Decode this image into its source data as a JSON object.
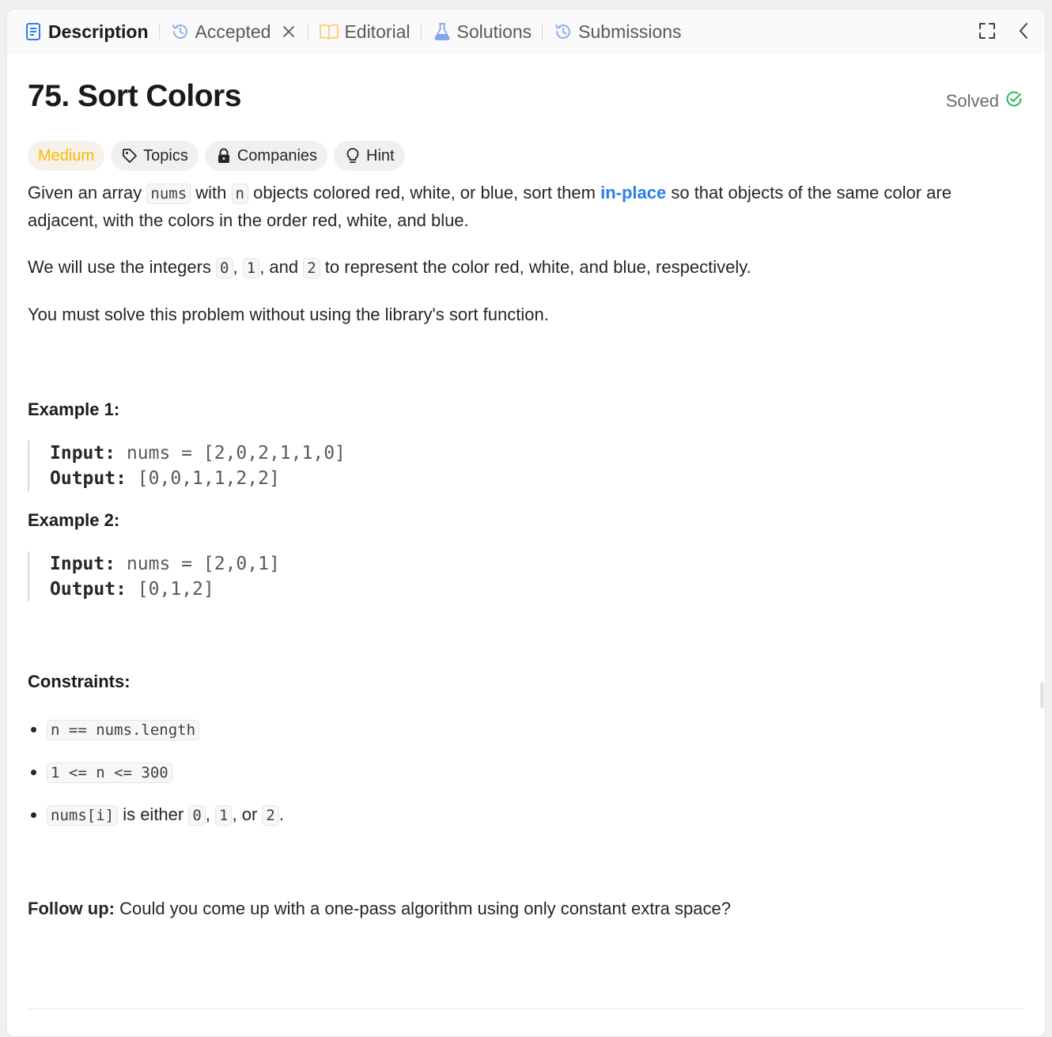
{
  "tabs": {
    "description": "Description",
    "accepted": "Accepted",
    "editorial": "Editorial",
    "solutions": "Solutions",
    "submissions": "Submissions"
  },
  "problem": {
    "title": "75. Sort Colors",
    "status": "Solved",
    "difficulty": "Medium",
    "chips": {
      "topics": "Topics",
      "companies": "Companies",
      "hint": "Hint"
    }
  },
  "description": {
    "p1": {
      "t1": "Given an array ",
      "c1": "nums",
      "t2": " with ",
      "c2": "n",
      "t3": " objects colored red, white, or blue, sort them ",
      "link": "in-place",
      "t4": " so that objects of the same color are adjacent, with the colors in the order red, white, and blue."
    },
    "p2": {
      "t1": "We will use the integers ",
      "c1": "0",
      "t2": ", ",
      "c2": "1",
      "t3": ", and ",
      "c3": "2",
      "t4": " to represent the color red, white, and blue, respectively."
    },
    "p3": "You must solve this problem without using the library's sort function."
  },
  "examples": [
    {
      "title": "Example 1:",
      "input_label": "Input:",
      "input": " nums = [2,0,2,1,1,0]",
      "output_label": "Output:",
      "output": " [0,0,1,1,2,2]"
    },
    {
      "title": "Example 2:",
      "input_label": "Input:",
      "input": " nums = [2,0,1]",
      "output_label": "Output:",
      "output": " [0,1,2]"
    }
  ],
  "constraints": {
    "title": "Constraints:",
    "c1": "n == nums.length",
    "c2": "1 <= n <= 300",
    "c3": {
      "code": "nums[i]",
      "t1": " is either ",
      "v1": "0",
      "t2": ", ",
      "v2": "1",
      "t3": ", or ",
      "v3": "2",
      "t4": "."
    }
  },
  "follow_up": {
    "label": "Follow up:",
    "text": " Could you come up with a one-pass algorithm using only constant extra space?"
  },
  "colors": {
    "medium": "#ffb800",
    "link": "#2b7de9",
    "solved_check": "#2db55d",
    "description_icon": "#2b7de9",
    "accepted_icon": "#8fb3e8",
    "editorial_icon": "#ffcf70",
    "solutions_icon": "#7ea6f0"
  }
}
